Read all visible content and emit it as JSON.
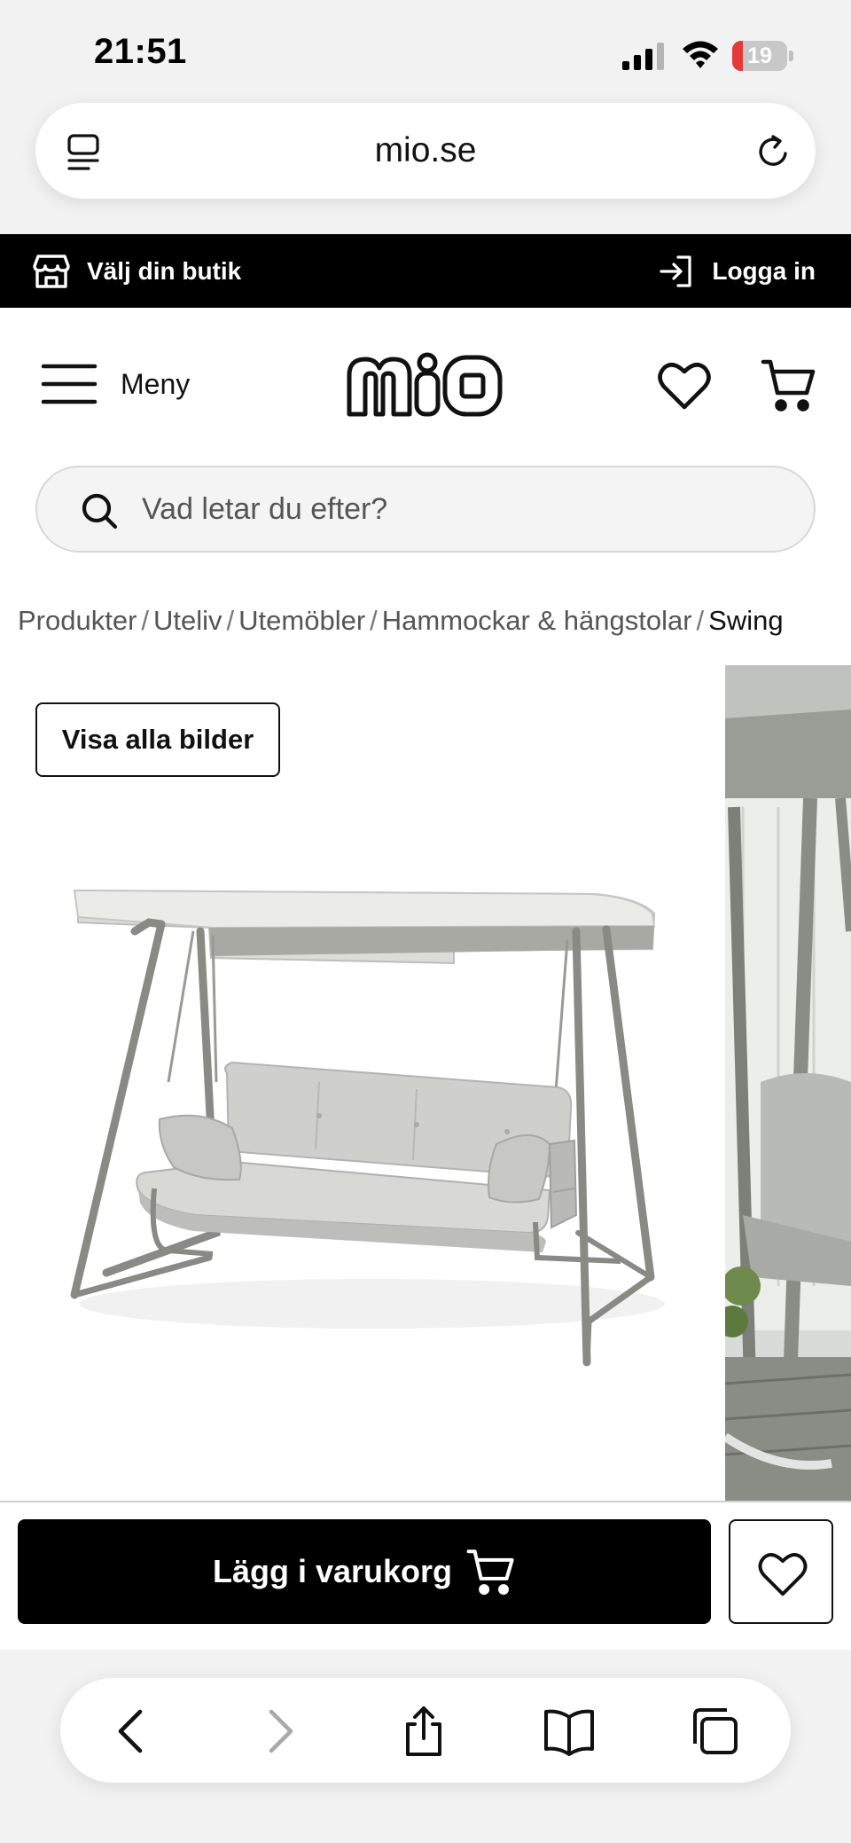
{
  "status_bar": {
    "time": "21:51",
    "battery_level": "19",
    "battery_fraction": 0.19,
    "icons": [
      "signal-icon",
      "wifi-icon",
      "battery-icon"
    ]
  },
  "browser": {
    "url": "mio.se",
    "icons": [
      "tab-icon",
      "reload-icon"
    ]
  },
  "top_strip": {
    "store_label": "Välj din butik",
    "login_label": "Logga in"
  },
  "header": {
    "menu_label": "Meny",
    "logo_text": "mio",
    "icons": [
      "hamburger-icon",
      "heart-icon",
      "cart-icon"
    ]
  },
  "search": {
    "placeholder": "Vad letar du efter?"
  },
  "breadcrumb": {
    "items": [
      "Produkter",
      "Uteliv",
      "Utemöbler",
      "Hammockar & hängstolar"
    ],
    "current": "Swing",
    "separator": "/"
  },
  "gallery": {
    "view_all_label": "Visa alla bilder"
  },
  "actions": {
    "add_to_cart_label": "Lägg i varukorg"
  },
  "bottom_toolbar": {
    "icons": [
      "back-icon",
      "forward-icon",
      "share-icon",
      "bookmarks-icon",
      "tabs-icon"
    ]
  },
  "colors": {
    "accent": "#000000",
    "battery_low": "#e5393b",
    "browser_chrome": "#f2f2f2"
  }
}
